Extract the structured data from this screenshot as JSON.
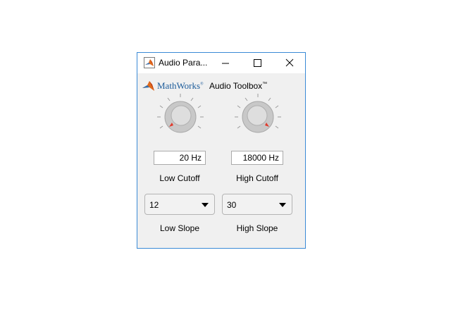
{
  "window": {
    "title": "Audio Para...",
    "border_color": "#3a8ad6",
    "background_color": "#f0f0f0"
  },
  "header": {
    "brand": "MathWorks",
    "brand_mark": "®",
    "product": "Audio Toolbox",
    "product_mark": "™",
    "brand_color": "#1b5b9a"
  },
  "controls": {
    "low_cutoff": {
      "value_text": "20 Hz",
      "label": "Low Cutoff"
    },
    "high_cutoff": {
      "value_text": "18000 Hz",
      "label": "High Cutoff"
    },
    "low_slope": {
      "selected": "12",
      "label": "Low Slope"
    },
    "high_slope": {
      "selected": "30",
      "label": "High Slope"
    }
  },
  "colors": {
    "knob_indicator": "#e03a2c",
    "knob_body": "#c8c8c8",
    "tick": "#9a9a9a"
  },
  "icons": {
    "app": "matlab-membrane-icon",
    "minimize": "minimize-icon",
    "maximize": "maximize-icon",
    "close": "close-icon",
    "dropdown": "caret-down-icon"
  }
}
